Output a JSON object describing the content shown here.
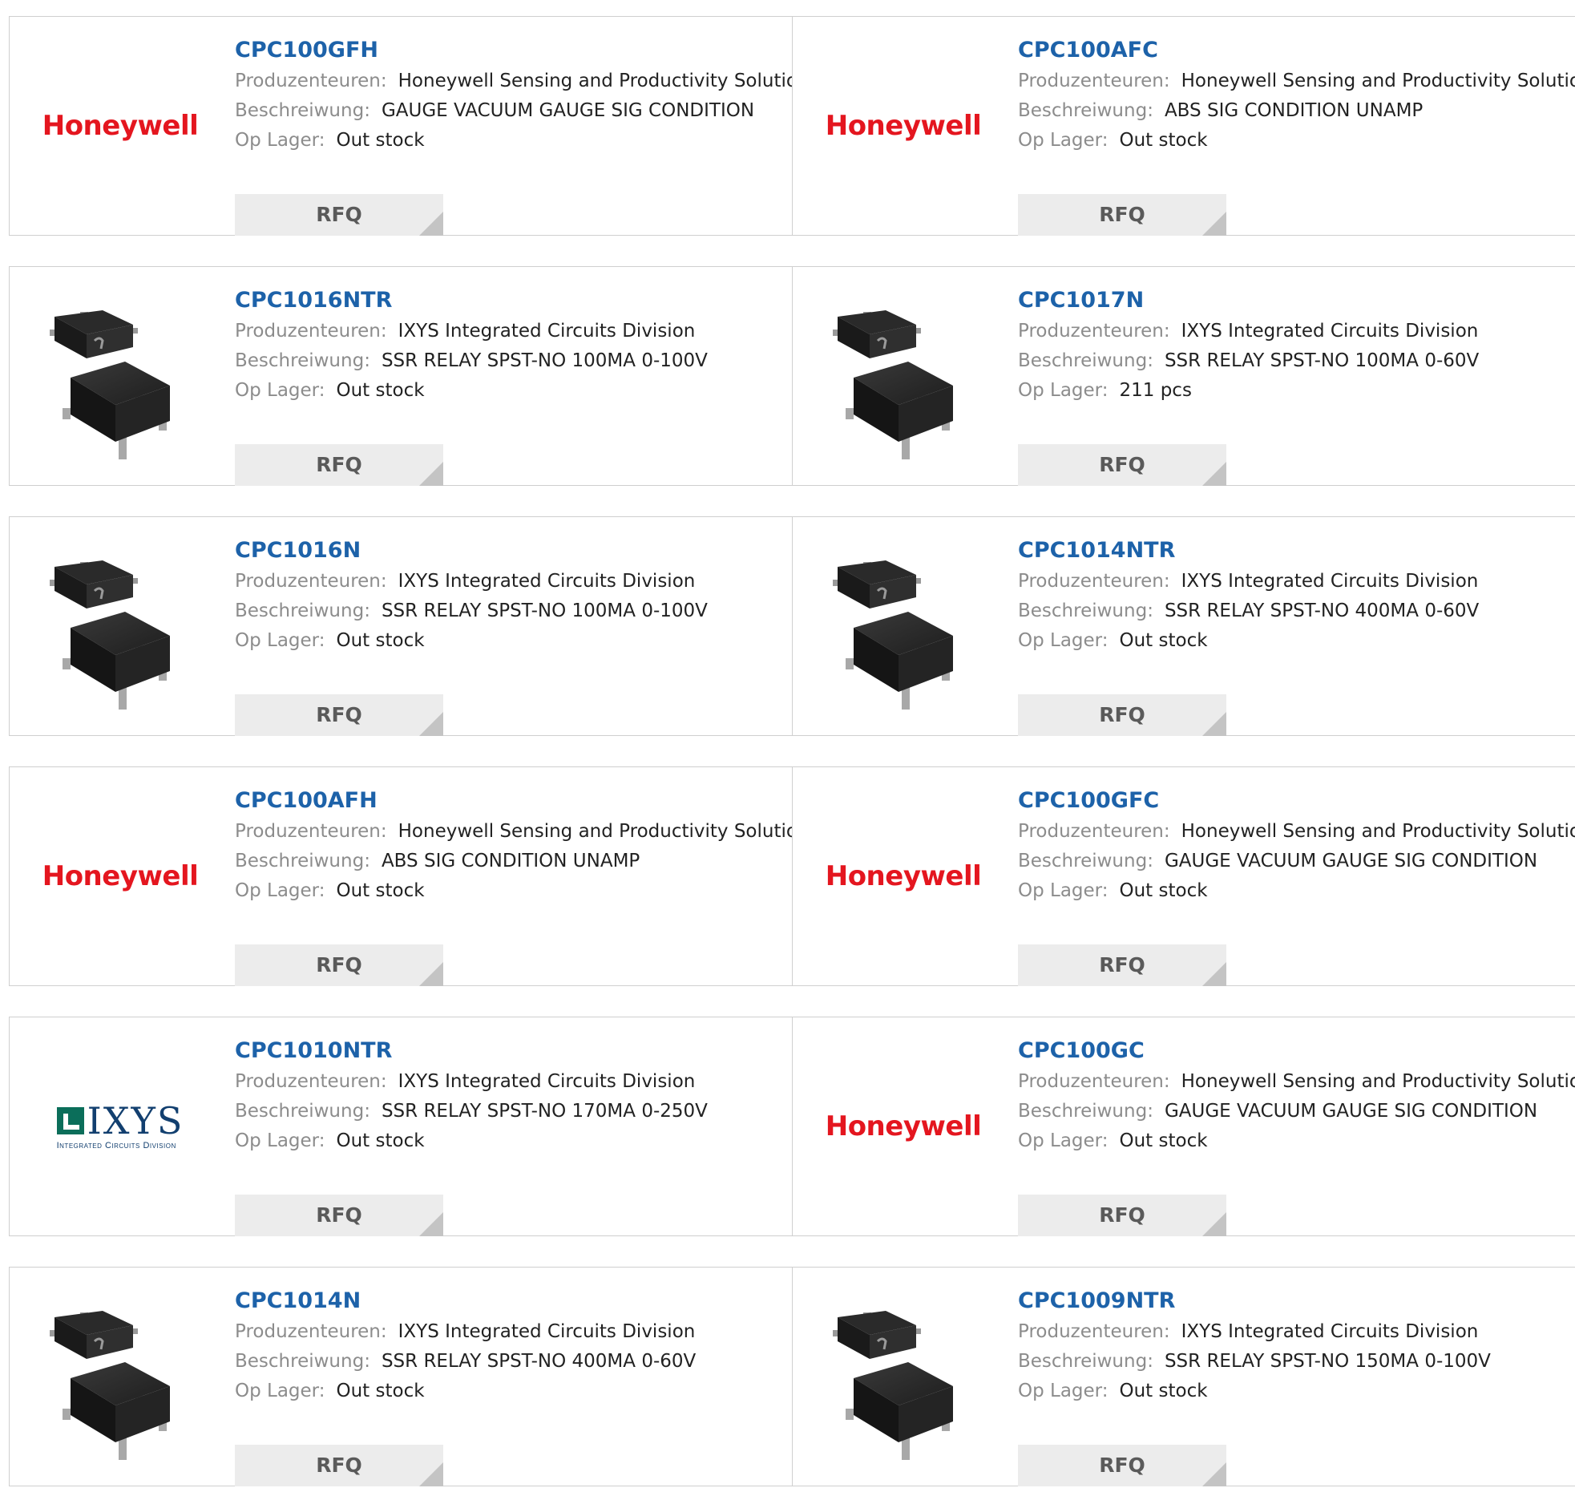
{
  "labels": {
    "manufacturer": "Produzenteuren:",
    "description": "Beschreiwung:",
    "stock": "Op Lager:",
    "rfq": "RFQ"
  },
  "logos": {
    "honeywell": "Honeywell",
    "ixys_word": "IXYS",
    "ixys_sub": "Integrated Circuits Division"
  },
  "products": [
    {
      "part": "CPC100GFH",
      "manufacturer": "Honeywell Sensing and Productivity Solutions",
      "description": "GAUGE VACUUM GAUGE SIG CONDITION",
      "stock": "Out stock",
      "image": "honeywell-logo"
    },
    {
      "part": "CPC100AFC",
      "manufacturer": "Honeywell Sensing and Productivity Solutions",
      "description": "ABS SIG CONDITION UNAMP",
      "stock": "Out stock",
      "image": "honeywell-logo"
    },
    {
      "part": "CPC1016NTR",
      "manufacturer": "IXYS Integrated Circuits Division",
      "description": "SSR RELAY SPST-NO 100MA 0-100V",
      "stock": "Out stock",
      "image": "chip-photo"
    },
    {
      "part": "CPC1017N",
      "manufacturer": "IXYS Integrated Circuits Division",
      "description": "SSR RELAY SPST-NO 100MA 0-60V",
      "stock": "211 pcs",
      "image": "chip-photo"
    },
    {
      "part": "CPC1016N",
      "manufacturer": "IXYS Integrated Circuits Division",
      "description": "SSR RELAY SPST-NO 100MA 0-100V",
      "stock": "Out stock",
      "image": "chip-photo"
    },
    {
      "part": "CPC1014NTR",
      "manufacturer": "IXYS Integrated Circuits Division",
      "description": "SSR RELAY SPST-NO 400MA 0-60V",
      "stock": "Out stock",
      "image": "chip-photo"
    },
    {
      "part": "CPC100AFH",
      "manufacturer": "Honeywell Sensing and Productivity Solutions",
      "description": "ABS SIG CONDITION UNAMP",
      "stock": "Out stock",
      "image": "honeywell-logo"
    },
    {
      "part": "CPC100GFC",
      "manufacturer": "Honeywell Sensing and Productivity Solutions",
      "description": "GAUGE VACUUM GAUGE SIG CONDITION",
      "stock": "Out stock",
      "image": "honeywell-logo"
    },
    {
      "part": "CPC1010NTR",
      "manufacturer": "IXYS Integrated Circuits Division",
      "description": "SSR RELAY SPST-NO 170MA 0-250V",
      "stock": "Out stock",
      "image": "ixys-logo"
    },
    {
      "part": "CPC100GC",
      "manufacturer": "Honeywell Sensing and Productivity Solutions",
      "description": "GAUGE VACUUM GAUGE SIG CONDITION",
      "stock": "Out stock",
      "image": "honeywell-logo"
    },
    {
      "part": "CPC1014N",
      "manufacturer": "IXYS Integrated Circuits Division",
      "description": "SSR RELAY SPST-NO 400MA 0-60V",
      "stock": "Out stock",
      "image": "chip-photo"
    },
    {
      "part": "CPC1009NTR",
      "manufacturer": "IXYS Integrated Circuits Division",
      "description": "SSR RELAY SPST-NO 150MA 0-100V",
      "stock": "Out stock",
      "image": "chip-photo"
    }
  ],
  "colors": {
    "part_link": "#1d62a9",
    "label": "#8c8c8c",
    "honeywell_red": "#e4161f",
    "ixys_green": "#0b6e5a",
    "ixys_blue": "#123f6f",
    "rfq_bg": "#ececec"
  }
}
